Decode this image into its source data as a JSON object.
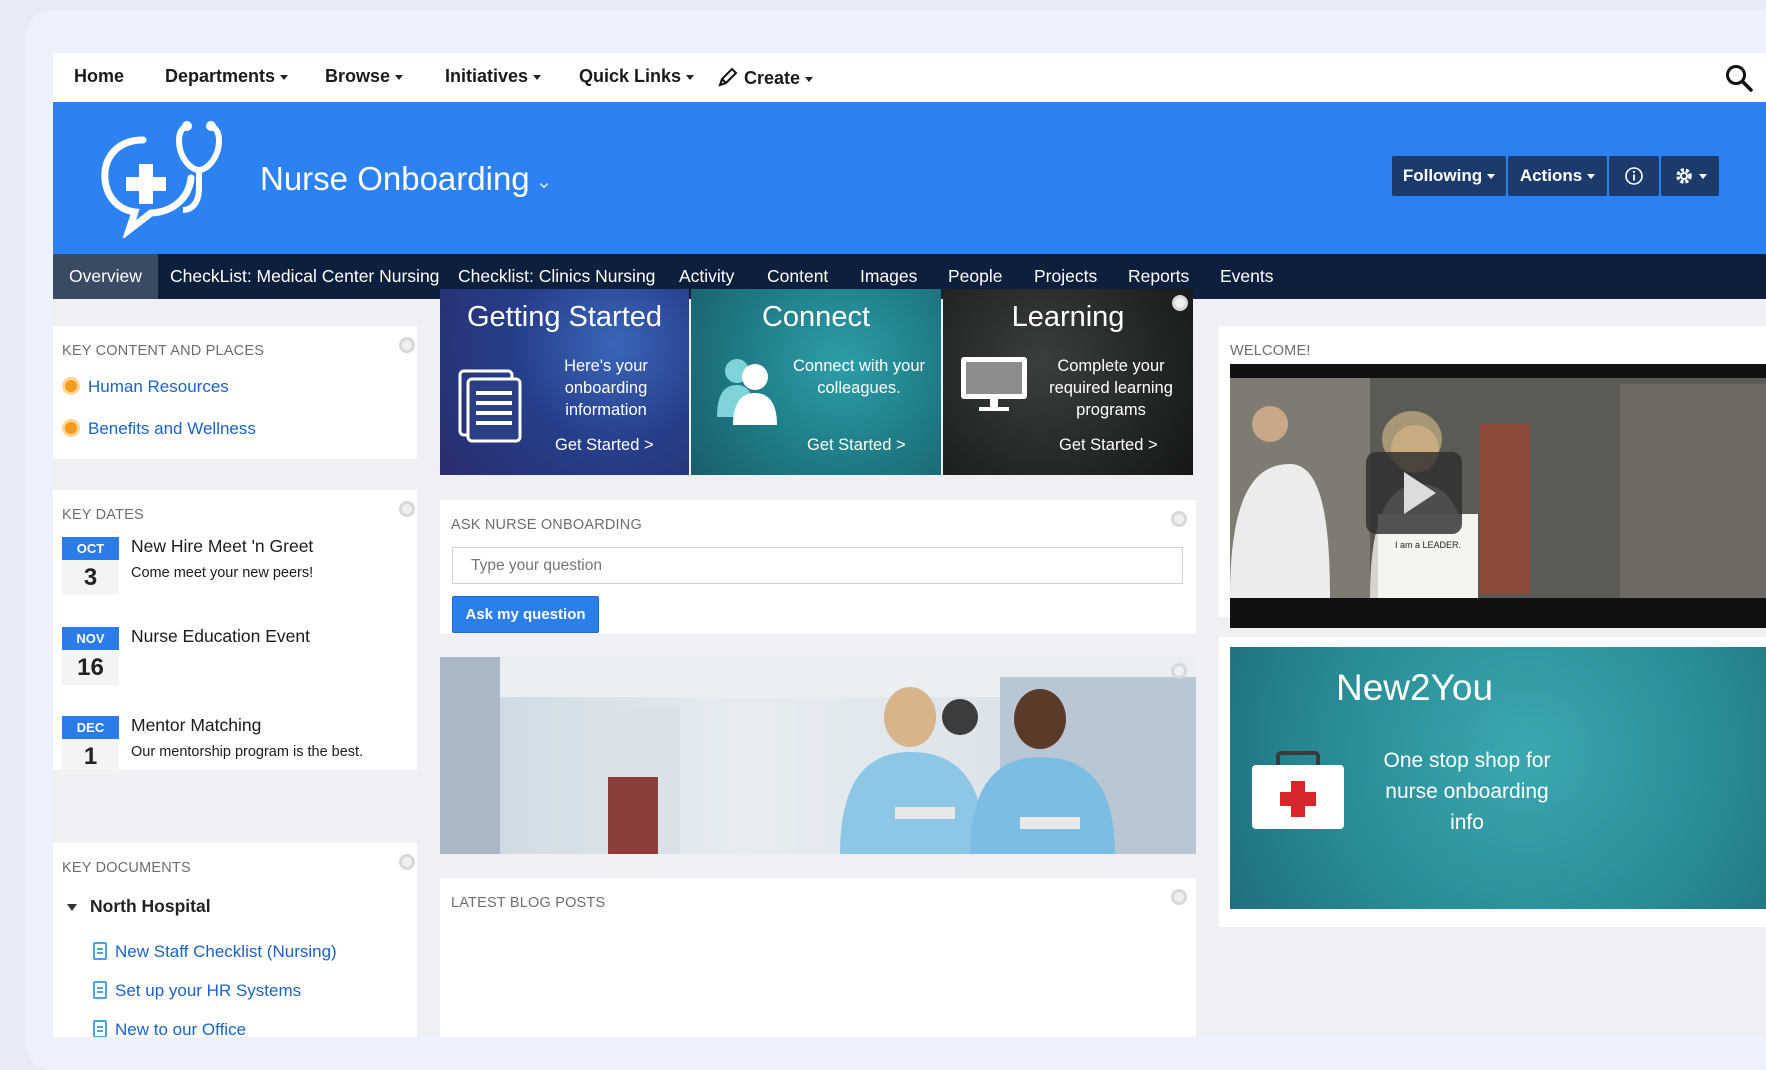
{
  "nav": {
    "home": "Home",
    "departments": "Departments",
    "browse": "Browse",
    "initiatives": "Initiatives",
    "quick_links": "Quick Links",
    "create": "Create"
  },
  "place": {
    "title": "Nurse Onboarding",
    "buttons": {
      "following": "Following",
      "actions": "Actions"
    }
  },
  "tabs": [
    "Overview",
    "CheckList: Medical Center Nursing",
    "Checklist: Clinics Nursing",
    "Activity",
    "Content",
    "Images",
    "People",
    "Projects",
    "Reports",
    "Events"
  ],
  "key_content": {
    "title": "KEY CONTENT AND PLACES",
    "items": [
      "Human Resources",
      "Benefits and Wellness"
    ]
  },
  "key_dates": {
    "title": "KEY DATES",
    "events": [
      {
        "month": "OCT",
        "day": "3",
        "title": "New Hire Meet 'n Greet",
        "desc": "Come meet your new peers!"
      },
      {
        "month": "NOV",
        "day": "16",
        "title": "Nurse Education Event",
        "desc": ""
      },
      {
        "month": "DEC",
        "day": "1",
        "title": "Mentor Matching",
        "desc": "Our mentorship program is the best."
      }
    ]
  },
  "key_documents": {
    "title": "KEY DOCUMENTS",
    "folder": "North Hospital",
    "docs": [
      "New Staff Checklist (Nursing)",
      "Set up your HR Systems",
      "New to our Office"
    ]
  },
  "tiles": [
    {
      "title": "Getting Started",
      "desc": "Here's your onboarding information",
      "cta": "Get Started >"
    },
    {
      "title": "Connect",
      "desc": "Connect with your colleagues.",
      "cta": "Get Started >"
    },
    {
      "title": "Learning",
      "desc": "Complete your required learning programs",
      "cta": "Get Started >"
    }
  ],
  "ask": {
    "title": "ASK NURSE ONBOARDING",
    "placeholder": "Type your question",
    "button": "Ask my question"
  },
  "blog": {
    "title": "LATEST BLOG POSTS"
  },
  "welcome": {
    "title": "WELCOME!",
    "sign_text": "I am a LEADER."
  },
  "promo": {
    "title": "New2You",
    "desc": "One stop shop for nurse onboarding info"
  },
  "colors": {
    "brand_blue": "#2c82f2",
    "tab_bar": "#0d1f3c",
    "link": "#1a63c6",
    "date_badge": "#2b7be8"
  }
}
